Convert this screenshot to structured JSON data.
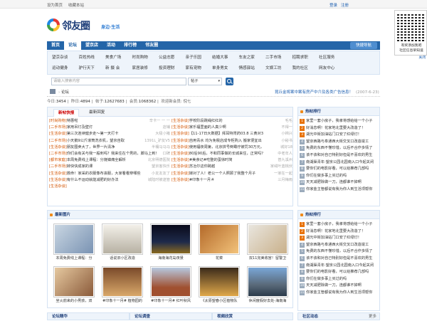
{
  "topbar": {
    "set_home": "设为首页",
    "bookmark": "收藏本站",
    "login": "登录",
    "register": "注册"
  },
  "logo": {
    "name": "邻友圈",
    "slogan": "身边·生活"
  },
  "qr": {
    "line1": "有奖添加我吧",
    "line2": "社区信息早知道",
    "close": "关闭"
  },
  "nav": {
    "items": [
      "首页",
      "论坛",
      "望京店",
      "活动",
      "排行榜",
      "邻友圈"
    ],
    "active": 1,
    "quick": "快捷导航"
  },
  "subnav": {
    "row1": [
      "望京杂谈",
      "百姓热线",
      "美食广场",
      "时尚购物",
      "公益志愿",
      "亲子乐园",
      "结婚大事",
      "车友之家",
      "二手市场",
      "招聘求职",
      "社区服务"
    ],
    "row2": [
      "运动健身",
      "驴行天下",
      "新 摄 会",
      "家居装修",
      "投资理财",
      "家有宠物",
      "单身男女",
      "情感驿站",
      "文娱工坊",
      "我的社区",
      "网友中心"
    ]
  },
  "search": {
    "placeholder": "请输入搜索内容",
    "select": "帖子"
  },
  "crumb": {
    "label": "论坛",
    "notice": "昆丘金将案中案有房产中介及各类广告信息！",
    "date": "(2007-6-23)"
  },
  "stats": {
    "today_label": "今日:",
    "today": "3454",
    "yesterday_label": "昨日:",
    "yesterday": "4894",
    "posts_label": "帖子:",
    "posts": "12627683",
    "members_label": "会员:",
    "members": "1068362",
    "welcome": "欢迎新会员: 倪七"
  },
  "news": {
    "tabs": [
      "新帖快报",
      "最新回复"
    ],
    "left": [
      {
        "c": "[时尚购物]",
        "t": "特惠啦",
        "a": "辛卡一 一 一"
      },
      {
        "c": "[二手市场]",
        "t": "家用吊灯及壁灯",
        "a": "店铺"
      },
      {
        "c": "[生活杂谈]",
        "t": "第三次连续健步走～第一天打卡",
        "a": "大极小猪"
      },
      {
        "c": "[二手市场]",
        "t": "小天鹅9公斤滚筒洗衣机，望京自取",
        "a": "1391L_驴友V5"
      },
      {
        "c": "[生活杂谈]",
        "t": "朋友圈卖大了，世界一片清净",
        "a": "半桶马马马"
      },
      {
        "c": "[二手市场]",
        "t": "你们会有关与我一般刺吗？我来住在个男的，脚马上到！",
        "a": "口碑"
      },
      {
        "c": "[都市家庭]",
        "t": "本周免费线上课程：分娩镇痛全解析",
        "a": "北京明德医院"
      },
      {
        "c": "[二手市场]",
        "t": "转快快成家的课",
        "a": "望京客快乐"
      },
      {
        "c": "[生活杂谈]",
        "t": "救命！家采的衣服像布丧服，大家看看穿哪些",
        "a": "小友友友了"
      },
      {
        "c": "[生活杂谈]",
        "t": "有什么不运动就能减肥的好办法",
        "a": "城陆时被逮管"
      },
      {
        "c": "[生活杂谈]",
        "t": "",
        "a": ""
      }
    ],
    "right": [
      {
        "c": "[生活杂谈]",
        "t": "学校阶段跳绳红红的",
        "a": "毛毛"
      },
      {
        "c": "[生活杂谈]",
        "t": "家乐福里面的人真少啊",
        "a": "不得一"
      },
      {
        "c": "[生活杂谈]",
        "t": "【11-17日大数据】拜耳特胃药03.8 三黄对3",
        "a": "小棉兴"
      },
      {
        "c": "[生活杂谈]",
        "t": "自用青水 均为免税店成专柜购入 搬家便宜出",
        "a": "小秘书"
      },
      {
        "c": "[生活杂谈]",
        "t": "使用福夜周第，北京拼号倒霉疗被罚30万元，",
        "a": "城好18"
      },
      {
        "c": "[生活杂谈]",
        "t": "80后90后，不和同事做的长城来住，正常吗？",
        "a": "中老年人"
      },
      {
        "c": "[生活杂谈]",
        "t": "#美食记#吃整的蛋徐时简",
        "a": "普九溪州"
      },
      {
        "c": "[生活杂谈]",
        "t": "苏冶尔这你跨越",
        "a": "家绒叶蓝桃伏"
      },
      {
        "c": "[生活杂谈]",
        "t": "嫁对了人！老公一个人照顾了我整个月子",
        "a": "一家在一起"
      },
      {
        "c": "[生活杂谈]",
        "t": "#印象十一月＃",
        "a": "三月梅雨"
      },
      {
        "c": "",
        "t": "",
        "a": ""
      }
    ]
  },
  "hot": {
    "title": "热帖排行",
    "items": [
      "家里一套小房子，我孝将感给给一个小子",
      "好消息啊！花家地北里要大改造了！",
      "湖光中街加油站门口安了红绿灯！",
      "望京西路与阜通西大街交叉口改造竣工",
      "免费的东西不懂珍惜，以后不合作多情了",
      "该不该和对自己特别好但是不喜欢的男生",
      "南湖渠青年·望京公园北园南入口今起关闭",
      "要你们的电影好看，可以给推荐几部吗",
      "你们在做多事上买过的吗",
      "天天减肥除做一刀，连都谁不掉啊",
      "你家金主管都说有我为你人到生活项帮你"
    ]
  },
  "hot2": {
    "title": "热帖排行",
    "items": [
      "家里一套小房子，我孝将感给给一个小子",
      "好消息啊！花家地北里要大改造了！",
      "湖光中街加油站门口安了红绿灯！",
      "望京西路与阜通西大街交叉口改造竣工",
      "免费的东西不懂珍惜，以后不合作多情了",
      "该不该和对自己特别好但是不喜欢的男生",
      "南湖渠青年·望京公园北园南入口今起关闭",
      "要你们的电影好看，可以给推荐几部吗",
      "你们在做多事上买过的吗",
      "天天减肥除做一刀，连都谁不掉啊",
      "你家金主管都说有我为你人到生活项帮你"
    ]
  },
  "pics": {
    "title": "最新图片",
    "row1": [
      "本周免费线上课程：分",
      "话说旧小区改造",
      "海南海花岛夜景",
      "花菜",
      "双11完美收官！留警卫"
    ],
    "row2": [
      "坐火前来的小男孩，双",
      "#印象十一月# 植物园的",
      "#印象十一月# 红叶秋风",
      "《太原望春小区植物队",
      "休闲度假好去处-海南海"
    ]
  },
  "bottom": {
    "b1": "论坛精华",
    "b2": "论坛调查",
    "b3": "视频欣赏",
    "b4": "社区动态",
    "more": "更多"
  }
}
